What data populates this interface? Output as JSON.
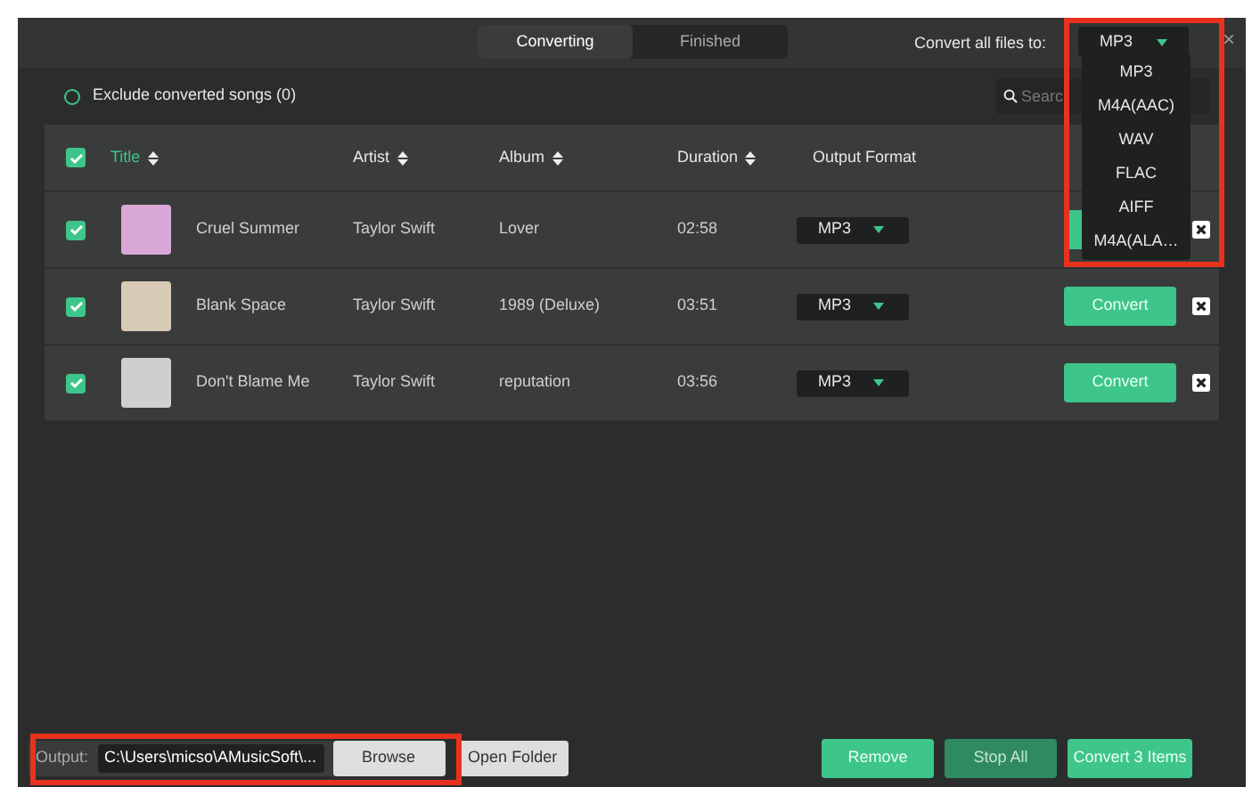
{
  "tabs": [
    {
      "label": "Converting",
      "selected": true
    },
    {
      "label": "Finished",
      "selected": false
    }
  ],
  "convert_all": {
    "label": "Convert all files to:",
    "value": "MP3",
    "options": [
      "MP3",
      "M4A(AAC)",
      "WAV",
      "FLAC",
      "AIFF",
      "M4A(ALA…"
    ]
  },
  "close": "×",
  "exclude": {
    "label": "Exclude converted songs (0)",
    "checked": false
  },
  "search": {
    "placeholder": "Searc"
  },
  "table": {
    "all_checked": true,
    "columns": [
      "Title",
      "Artist",
      "Album",
      "Duration",
      "Output Format"
    ],
    "rows": [
      {
        "checked": true,
        "title": "Cruel Summer",
        "artist": "Taylor Swift",
        "album": "Lover",
        "duration": "02:58",
        "format": "MP3"
      },
      {
        "checked": true,
        "title": "Blank Space",
        "artist": "Taylor Swift",
        "album": "1989 (Deluxe)",
        "duration": "03:51",
        "format": "MP3",
        "action": "Convert"
      },
      {
        "checked": true,
        "title": "Don't Blame Me",
        "artist": "Taylor Swift",
        "album": "reputation",
        "duration": "03:56",
        "format": "MP3",
        "action": "Convert"
      }
    ]
  },
  "footer": {
    "output_label": "Output:",
    "output_path": "C:\\Users\\micso\\AMusicSoft\\...",
    "browse": "Browse",
    "open_folder": "Open Folder",
    "remove": "Remove",
    "stop_all": "Stop All",
    "convert_items": "Convert 3 Items"
  }
}
